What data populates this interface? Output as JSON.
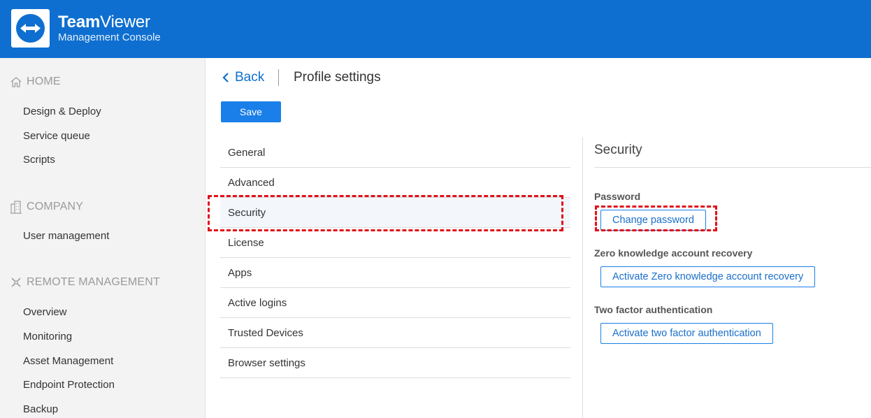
{
  "header": {
    "brand_bold": "Team",
    "brand_rest": "Viewer",
    "brand_sub": "Management Console"
  },
  "sidebar": {
    "sections": [
      {
        "label": "HOME",
        "icon": "home-icon",
        "items": [
          "Design & Deploy",
          "Service queue",
          "Scripts"
        ]
      },
      {
        "label": "COMPANY",
        "icon": "building-icon",
        "items": [
          "User management"
        ]
      },
      {
        "label": "REMOTE MANAGEMENT",
        "icon": "network-icon",
        "items": [
          "Overview",
          "Monitoring",
          "Asset Management",
          "Endpoint Protection",
          "Backup"
        ]
      }
    ]
  },
  "toolbar": {
    "back_label": "Back",
    "page_title": "Profile settings",
    "save_label": "Save"
  },
  "menu": {
    "items": [
      "General",
      "Advanced",
      "Security",
      "License",
      "Apps",
      "Active logins",
      "Trusted Devices",
      "Browser settings"
    ],
    "active": "Security"
  },
  "security": {
    "title": "Security",
    "password_label": "Password",
    "change_password_label": "Change password",
    "zero_knowledge_label": "Zero knowledge account recovery",
    "zero_knowledge_button": "Activate Zero knowledge account recovery",
    "two_factor_label": "Two factor authentication",
    "two_factor_button": "Activate two factor authentication"
  },
  "colors": {
    "brand_blue": "#0e6fd0",
    "button_blue": "#1a7fe8",
    "highlight_red": "#e0101a"
  }
}
